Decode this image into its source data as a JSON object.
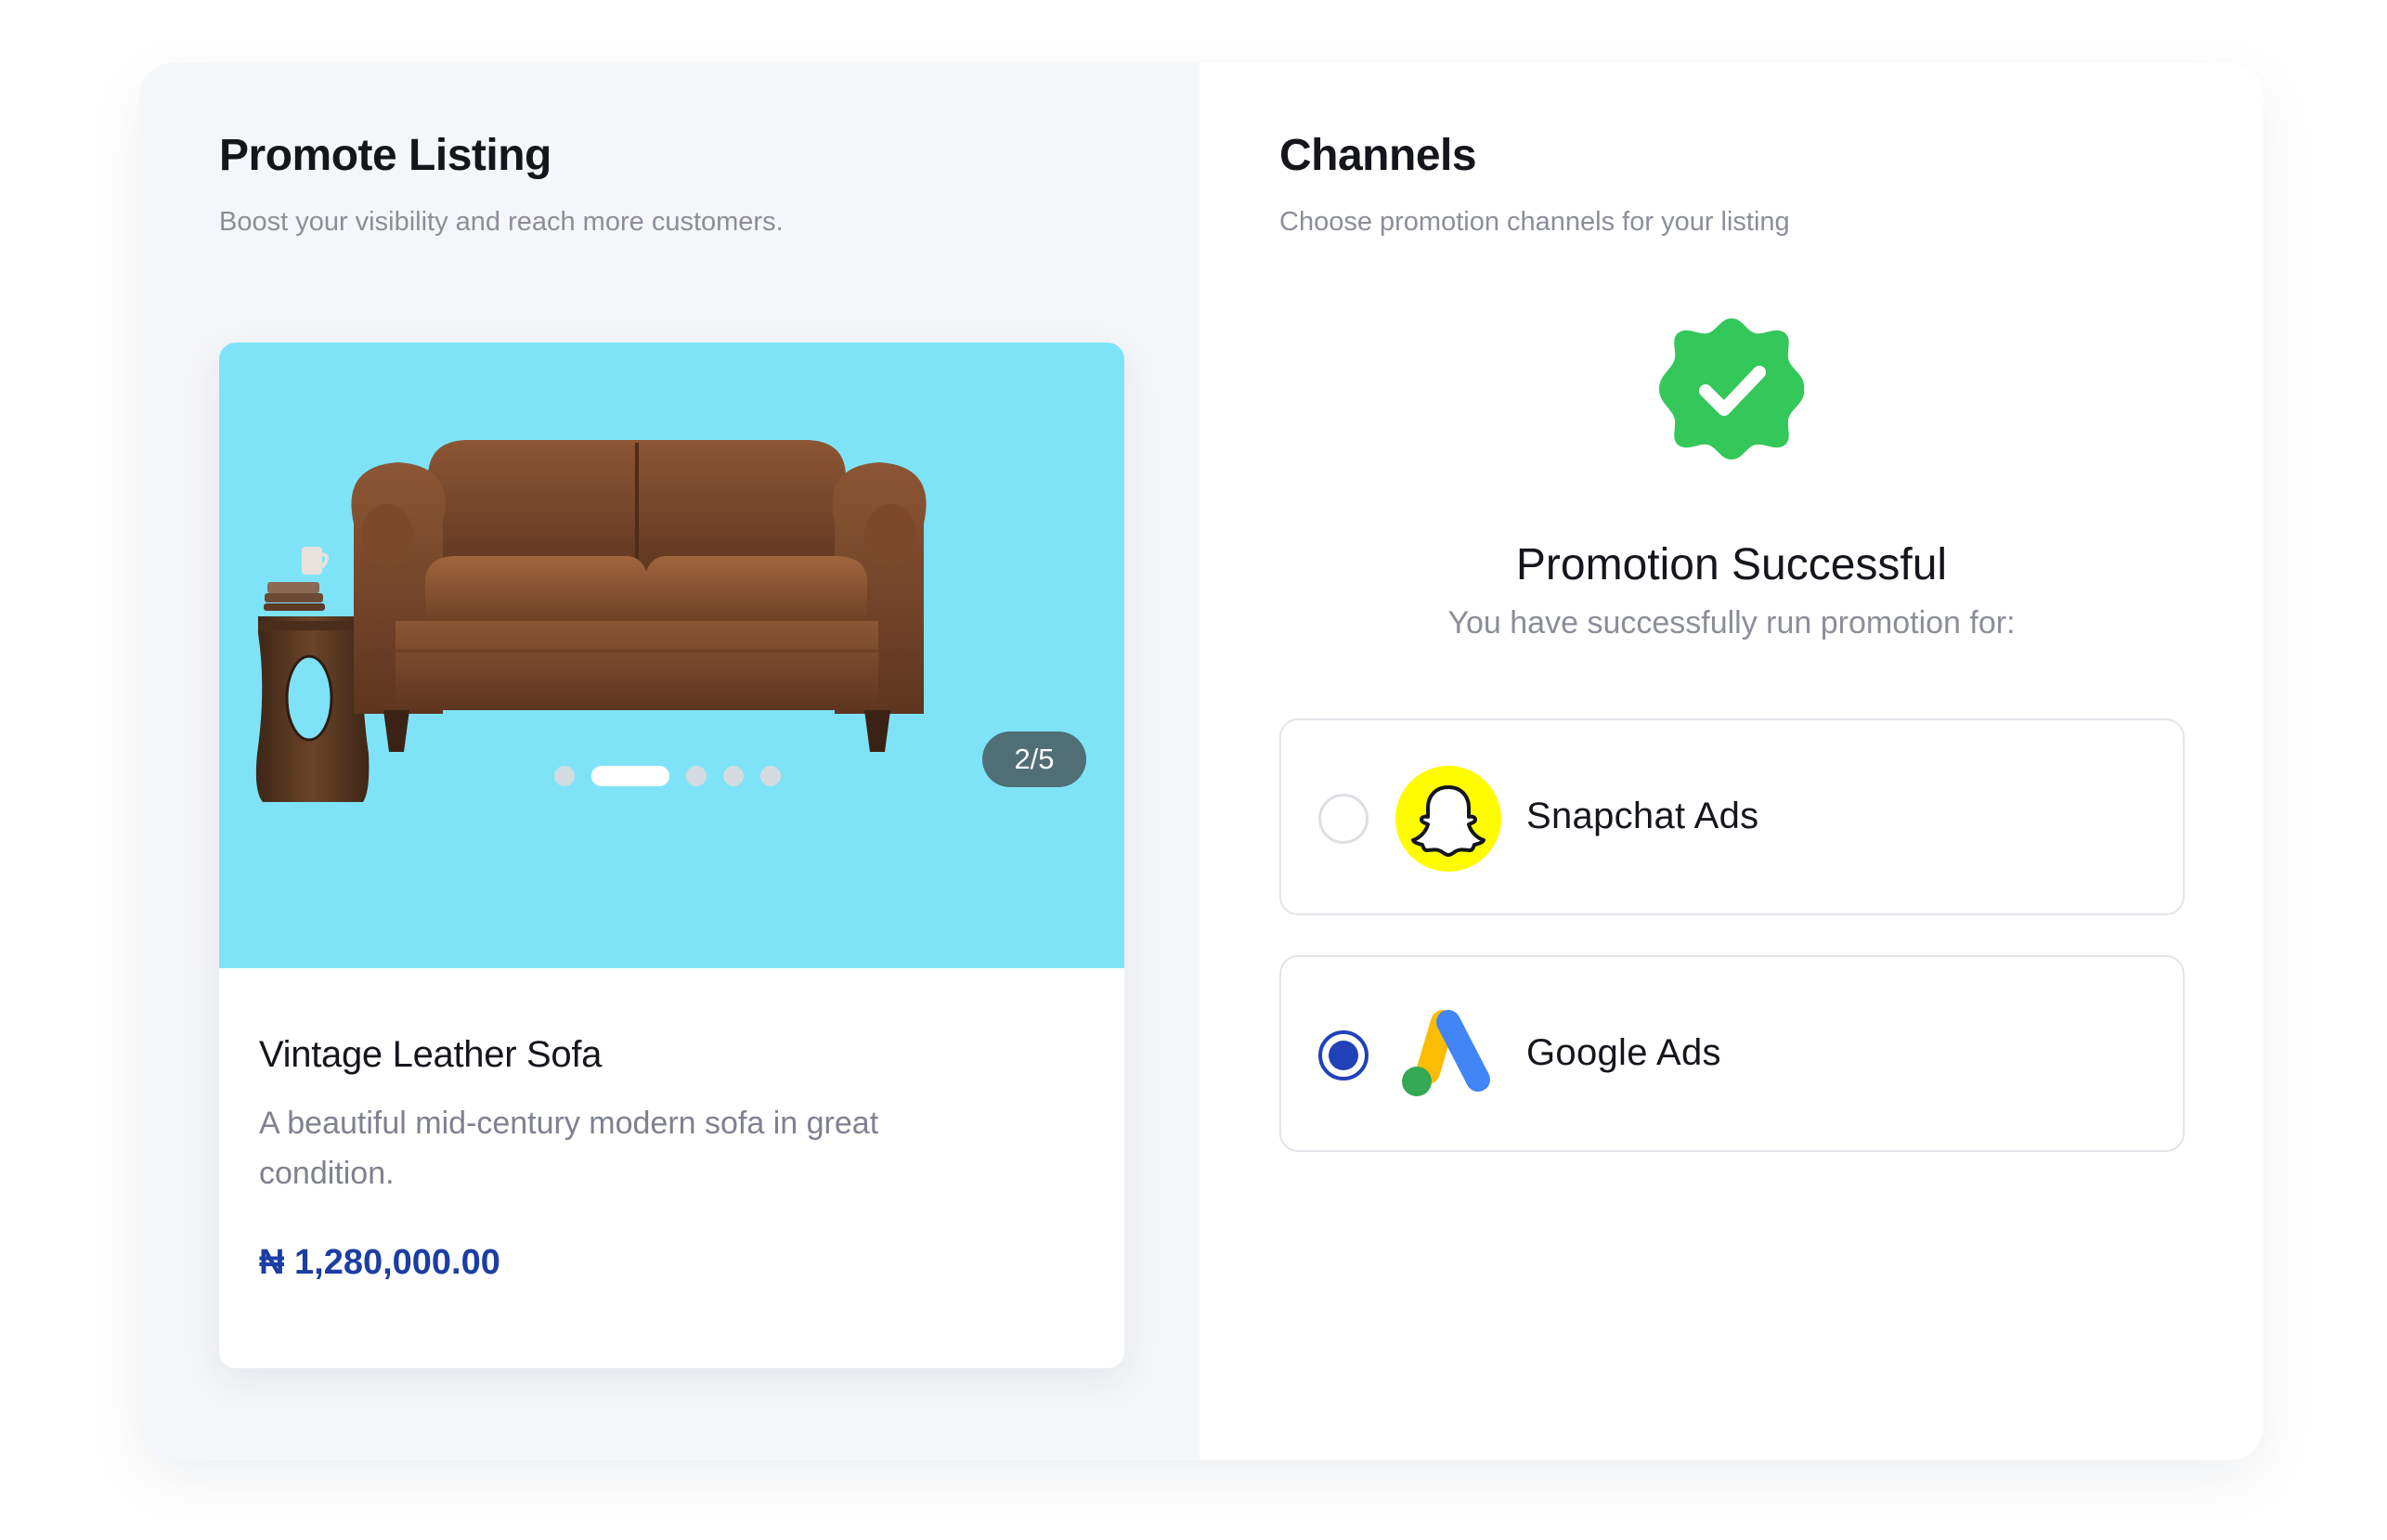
{
  "promote": {
    "title": "Promote Listing",
    "subtitle": "Boost your visibility and reach more customers."
  },
  "listing": {
    "name": "Vintage Leather Sofa",
    "description": "A beautiful mid-century modern sofa in great condition.",
    "price": "₦ 1,280,000.00",
    "image_counter": "2/5",
    "carousel": {
      "current": 2,
      "total": 5
    },
    "image_background": "#7fe3f8"
  },
  "channels": {
    "title": "Channels",
    "subtitle": "Choose promotion channels for your listing",
    "success_title": "Promotion Successful",
    "success_subtitle": "You have successfully run promotion for:",
    "success_icon": "check-badge-icon",
    "success_color": "#34c759",
    "options": [
      {
        "label": "Snapchat Ads",
        "icon": "snapchat-ghost-icon",
        "selected": false
      },
      {
        "label": "Google Ads",
        "icon": "google-ads-icon",
        "selected": true
      }
    ]
  },
  "colors": {
    "accent": "#2041b8",
    "price": "#1c3ea3",
    "snapchat_yellow": "#fffc00"
  }
}
